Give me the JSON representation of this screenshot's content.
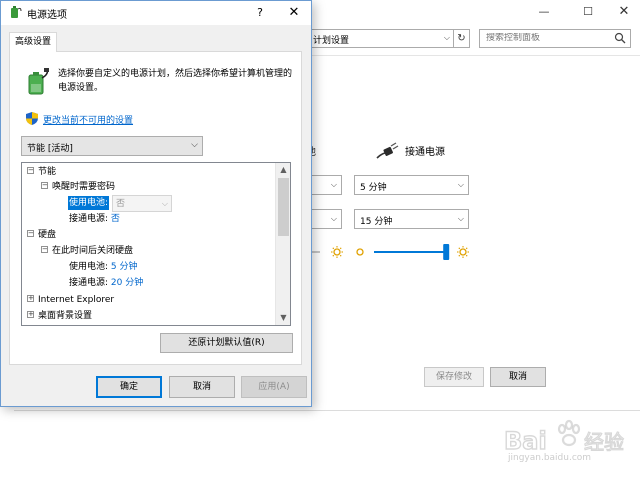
{
  "background_window": {
    "address_text": "计划设置",
    "search_placeholder": "搜索控制面板",
    "partial_char": "池",
    "plugged_in_label": "接通电源",
    "sleep_ac_value": "5 分钟",
    "display_ac_value": "15 分钟",
    "save_label": "保存修改",
    "cancel_label": "取消",
    "brightness_battery_level": 0.5,
    "brightness_ac_level": 0.95
  },
  "dialog": {
    "title": "电源选项",
    "help_glyph": "?",
    "close_glyph": "✕",
    "tab_label": "高级设置",
    "intro_text": "选择你要自定义的电源计划，然后选择你希望计算机管理的电源设置。",
    "change_link": "更改当前不可用的设置",
    "plan_select_value": "节能 [活动]",
    "tree": {
      "sleep": {
        "toggle": "⊟",
        "label": "节能"
      },
      "require_password": {
        "toggle": "⊟",
        "label": "唤醒时需要密码"
      },
      "battery_label": "使用电池:",
      "battery_value": "否",
      "plugged_label": "接通电源:",
      "plugged_value": "否",
      "hard_disk": {
        "toggle": "⊟",
        "label": "硬盘"
      },
      "turn_off_disk": {
        "toggle": "⊟",
        "label": "在此时间后关闭硬盘"
      },
      "disk_battery_label": "使用电池:",
      "disk_battery_value": "5 分钟",
      "disk_plugged_label": "接通电源:",
      "disk_plugged_value": "20 分钟",
      "ie": {
        "toggle": "⊞",
        "label": "Internet Explorer"
      },
      "desktop_bg": {
        "toggle": "⊞",
        "label": "桌面背景设置"
      }
    },
    "restore_label": "还原计划默认值(R)",
    "ok_label": "确定",
    "cancel_label": "取消",
    "apply_label": "应用(A)"
  },
  "watermark": {
    "brand": "Bai",
    "brand_suffix": "经验",
    "url": "jingyan.baidu.com"
  }
}
